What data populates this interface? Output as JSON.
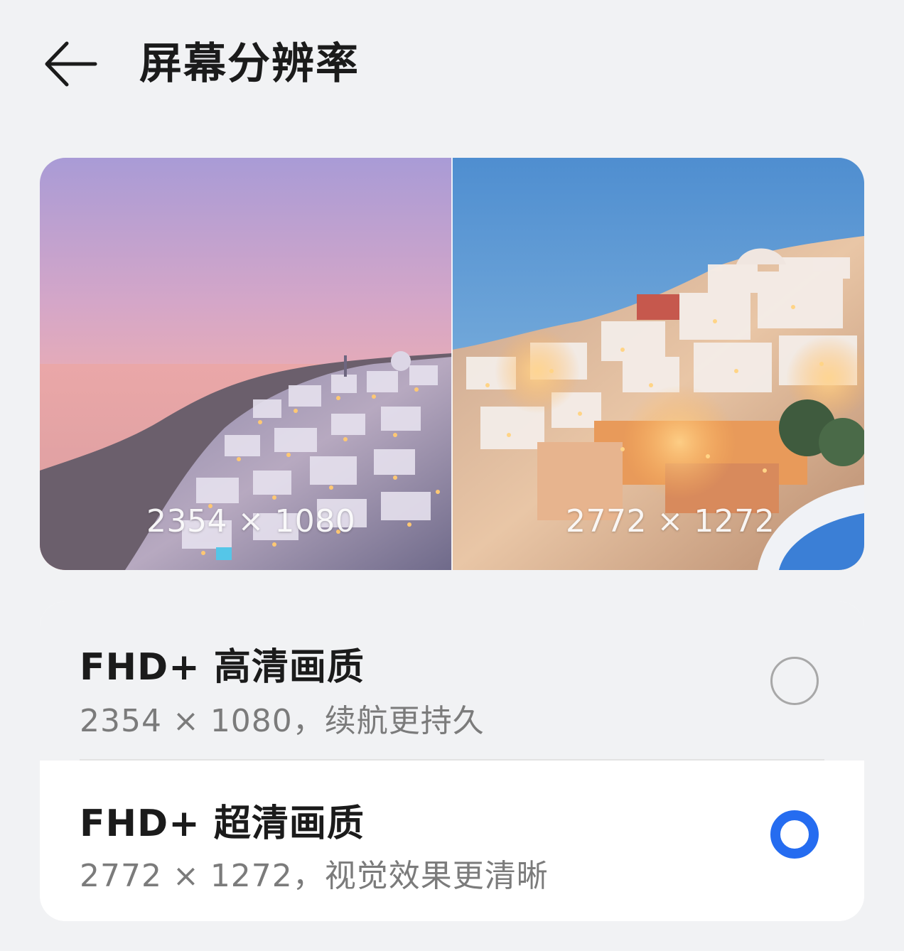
{
  "header": {
    "back_icon": "arrow-left-icon",
    "title": "屏幕分辨率"
  },
  "preview": {
    "left_label": "2354 × 1080",
    "right_label": "2772 × 1272"
  },
  "options": [
    {
      "title": "FHD+ 高清画质",
      "subtitle": "2354 × 1080，续航更持久",
      "selected": false
    },
    {
      "title": "FHD+ 超清画质",
      "subtitle": "2772 × 1272，视觉效果更清晰",
      "selected": true
    }
  ],
  "colors": {
    "accent": "#256cf0",
    "background": "#f1f2f4",
    "card": "#ffffff"
  }
}
